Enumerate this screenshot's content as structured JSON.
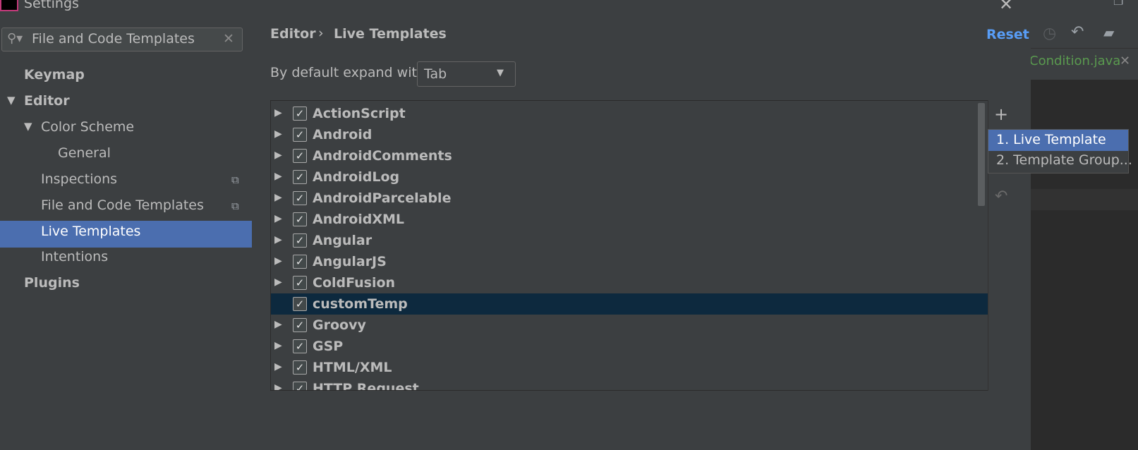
{
  "window": {
    "title": "Settings"
  },
  "search": {
    "value": "File and Code Templates"
  },
  "sidebar": {
    "items": [
      {
        "label": "Keymap"
      },
      {
        "label": "Editor"
      },
      {
        "label": "Color Scheme"
      },
      {
        "label": "General"
      },
      {
        "label": "Inspections"
      },
      {
        "label": "File and Code Templates"
      },
      {
        "label": "Live Templates"
      },
      {
        "label": "Intentions"
      },
      {
        "label": "Plugins"
      }
    ]
  },
  "breadcrumb": {
    "parent": "Editor",
    "separator": "›",
    "current": "Live Templates"
  },
  "reset_label": "Reset",
  "expand": {
    "label": "By default expand with",
    "value": "Tab"
  },
  "templates": [
    {
      "label": "ActionScript"
    },
    {
      "label": "Android"
    },
    {
      "label": "AndroidComments"
    },
    {
      "label": "AndroidLog"
    },
    {
      "label": "AndroidParcelable"
    },
    {
      "label": "AndroidXML"
    },
    {
      "label": "Angular"
    },
    {
      "label": "AngularJS"
    },
    {
      "label": "ColdFusion"
    },
    {
      "label": "customTemp"
    },
    {
      "label": "Groovy"
    },
    {
      "label": "GSP"
    },
    {
      "label": "HTML/XML"
    },
    {
      "label": "HTTP Request"
    }
  ],
  "popup": {
    "item1": "1. Live Template",
    "item2": "2. Template Group..."
  },
  "editor_tab": {
    "label": "Condition.java"
  },
  "colors": {
    "accent": "#4b6eaf",
    "link": "#589df6",
    "selected_row": "#0d293e",
    "background": "#3c3f41"
  }
}
